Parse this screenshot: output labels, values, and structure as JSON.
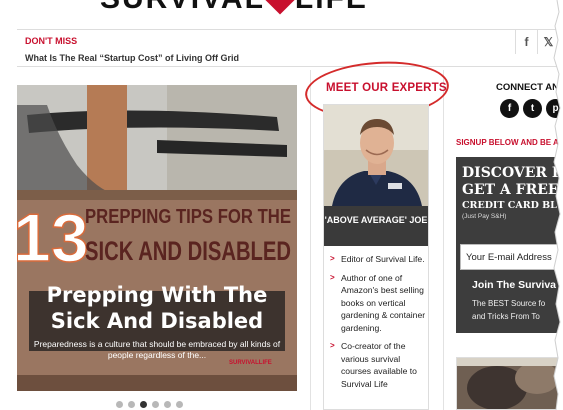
{
  "logo": {
    "text_left": "SURVIVAL",
    "text_right": "LIFE"
  },
  "dont_miss": {
    "label": "DON'T MISS",
    "headline": "What Is The Real “Startup Cost” of Living Off Grid",
    "share_icons": [
      "facebook-icon",
      "twitter-icon"
    ],
    "facebook_glyph": "f",
    "twitter_glyph": "𝕏"
  },
  "slider": {
    "image_title": "13 PREPPING TIPS FOR THE SICK AND DISABLED",
    "image_number": "13",
    "image_line1": "PREPPING TIPS FOR THE",
    "image_line2": "SICK AND DISABLED",
    "title": "Prepping With The Sick And Disabled",
    "caption": "Preparedness is a culture that should be embraced by all kinds of people regardless of the...",
    "mini_logo_left": "SURVIVAL",
    "mini_logo_right": "LIFE",
    "dot_count": 6,
    "active_dot": 2
  },
  "experts": {
    "heading": "MEET OUR EXPERTS",
    "name": "'ABOVE AVERAGE' JOE",
    "bio": [
      "Editor of Survival Life.",
      "Author of one of Amazon's best selling books on vertical gardening & container gardening.",
      "Co-creator of the various survival courses available to Survival Life"
    ]
  },
  "sidebar": {
    "connect_title": "CONNECT AN",
    "social": [
      "facebook-icon",
      "twitter-icon",
      "pinterest-icon"
    ],
    "social_glyphs": [
      "f",
      "t",
      "p"
    ],
    "signup_title": "SIGNUP BELOW AND BE A S",
    "ad_line1": "DISCOVER HO",
    "ad_line2": "GET A FREE",
    "ad_line3": "CREDIT CARD BL",
    "ad_line4": "(Just Pay S&H)",
    "email_placeholder": "Your E-mail Address",
    "join": "Join The Surviva",
    "best_line1": "The BEST Source fo",
    "best_line2": "and Tricks From To"
  },
  "colors": {
    "accent_red": "#c8102e",
    "dark": "#3a3a3a"
  }
}
